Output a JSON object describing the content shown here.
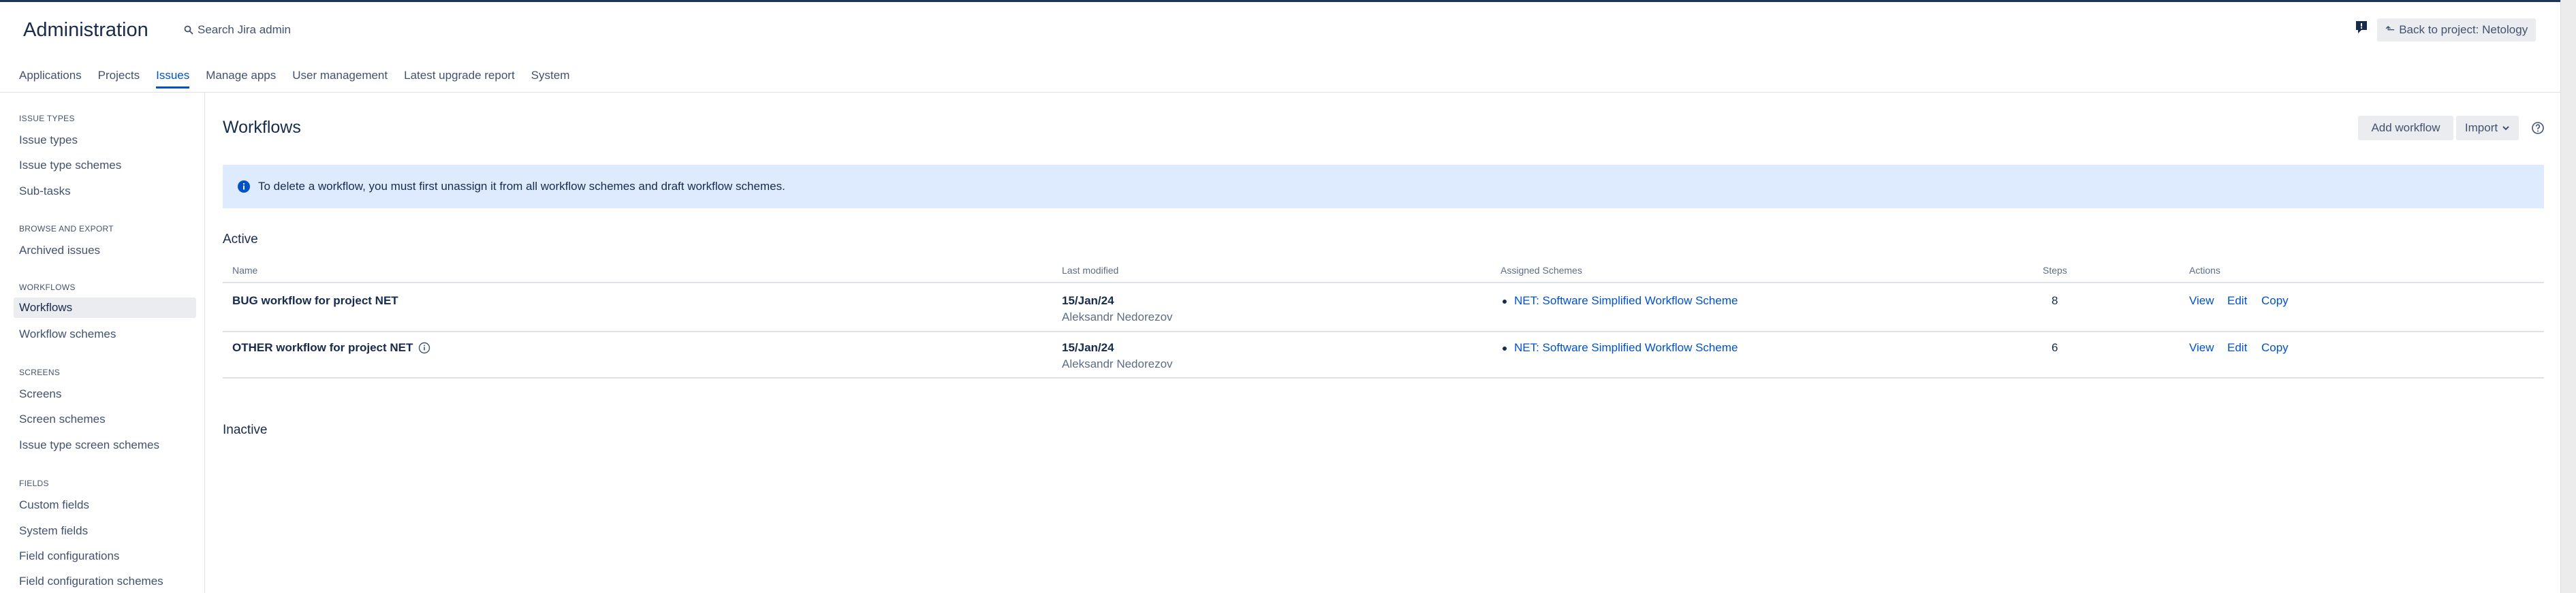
{
  "header": {
    "title": "Administration",
    "search_label": "Search Jira admin",
    "back_label": "Back to project: Netology"
  },
  "tabs": [
    {
      "label": "Applications"
    },
    {
      "label": "Projects"
    },
    {
      "label": "Issues"
    },
    {
      "label": "Manage apps"
    },
    {
      "label": "User management"
    },
    {
      "label": "Latest upgrade report"
    },
    {
      "label": "System"
    }
  ],
  "sidebar": {
    "sections": [
      {
        "title": "ISSUE TYPES",
        "items": [
          "Issue types",
          "Issue type schemes",
          "Sub-tasks"
        ]
      },
      {
        "title": "BROWSE AND EXPORT",
        "items": [
          "Archived issues"
        ]
      },
      {
        "title": "WORKFLOWS",
        "items": [
          "Workflows",
          "Workflow schemes"
        ]
      },
      {
        "title": "SCREENS",
        "items": [
          "Screens",
          "Screen schemes",
          "Issue type screen schemes"
        ]
      },
      {
        "title": "FIELDS",
        "items": [
          "Custom fields",
          "System fields",
          "Field configurations",
          "Field configuration schemes"
        ]
      }
    ]
  },
  "main": {
    "title": "Workflows",
    "add_label": "Add workflow",
    "import_label": "Import",
    "banner_text": "To delete a workflow, you must first unassign it from all workflow schemes and draft workflow schemes.",
    "active_label": "Active",
    "inactive_label": "Inactive",
    "columns": [
      "Name",
      "Last modified",
      "Assigned Schemes",
      "Steps",
      "Actions"
    ],
    "rows": [
      {
        "name": "BUG workflow for project NET",
        "date": "15/Jan/24",
        "author": "Aleksandr Nedorezov",
        "scheme": "NET: Software Simplified Workflow Scheme",
        "steps": "8",
        "view": "View",
        "edit": "Edit",
        "copy": "Copy"
      },
      {
        "name": "OTHER workflow for project NET",
        "date": "15/Jan/24",
        "author": "Aleksandr Nedorezov",
        "scheme": "NET: Software Simplified Workflow Scheme",
        "steps": "6",
        "view": "View",
        "edit": "Edit",
        "copy": "Copy"
      }
    ]
  },
  "colors": {
    "accent": "#0052cc",
    "banner": "#deebff",
    "selected_bg": "#ebecf0"
  }
}
